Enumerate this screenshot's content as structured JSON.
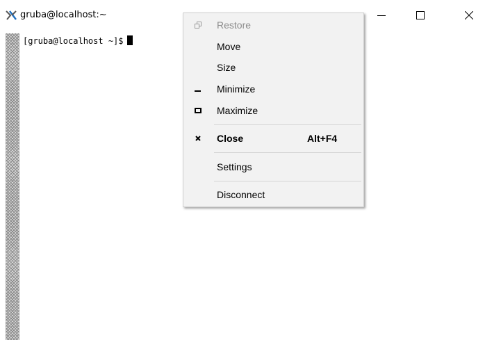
{
  "window": {
    "title": "gruba@localhost:~",
    "controls": {
      "minimize_icon": "minimize-icon",
      "maximize_icon": "maximize-icon",
      "close_icon": "close-icon"
    }
  },
  "terminal": {
    "prompt": "[gruba@localhost ~]$"
  },
  "menu": {
    "items": [
      {
        "label": "Restore",
        "icon": "restore-icon",
        "enabled": false
      },
      {
        "label": "Move",
        "enabled": true
      },
      {
        "label": "Size",
        "enabled": true
      },
      {
        "label": "Minimize",
        "icon": "minimize-icon",
        "enabled": true
      },
      {
        "label": "Maximize",
        "icon": "maximize-icon",
        "enabled": true
      },
      {
        "label": "Close",
        "icon": "close-icon",
        "shortcut": "Alt+F4",
        "enabled": true,
        "bold": true
      },
      {
        "label": "Settings",
        "enabled": true
      },
      {
        "label": "Disconnect",
        "enabled": true
      }
    ]
  },
  "colors": {
    "menu_background": "#f2f2f2",
    "disabled_text": "#8c8c8c",
    "separator": "#d4d4d4"
  }
}
